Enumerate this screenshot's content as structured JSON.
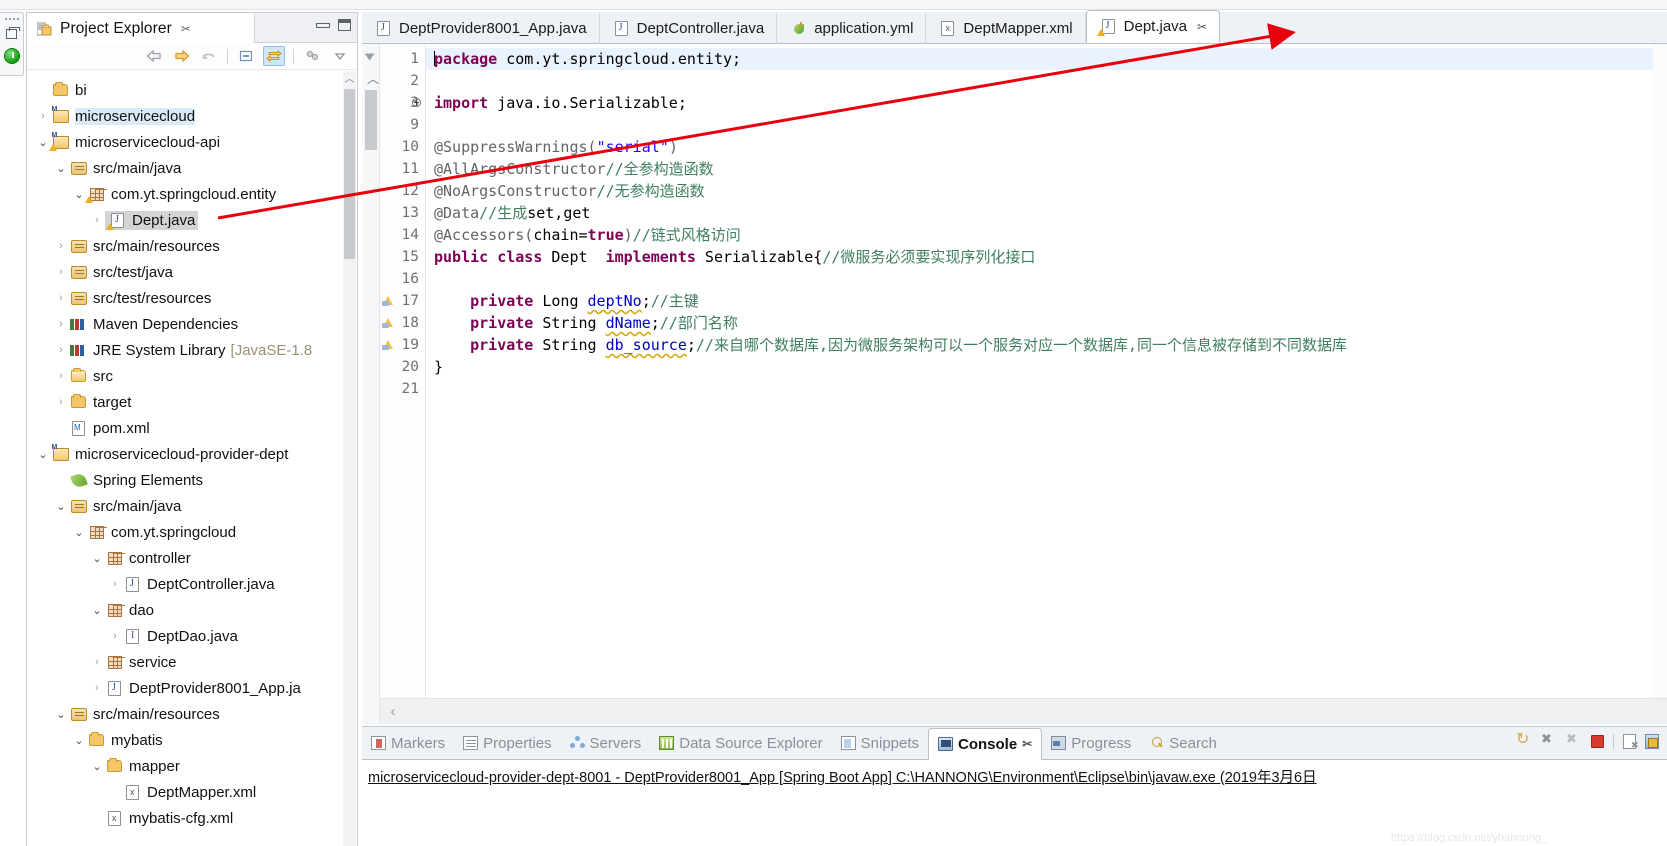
{
  "window": {
    "title": "Eclipse IDE"
  },
  "fastview": {
    "restore_tooltip": "Restore",
    "run_tooltip": "Run"
  },
  "project_explorer": {
    "title": "Project Explorer",
    "close_glyph": "✂",
    "minimize_tooltip": "Minimize",
    "maximize_tooltip": "Maximize",
    "toolbar": [
      {
        "name": "back-icon",
        "glyph": "⇦"
      },
      {
        "name": "forward-icon",
        "glyph": "⇨"
      },
      {
        "name": "up-icon",
        "glyph": "⬆"
      },
      {
        "name": "collapse-all-icon",
        "glyph": "▣"
      },
      {
        "name": "link-with-editor-icon",
        "glyph": "⇄"
      },
      {
        "name": "view-menu-icon",
        "glyph": "▽"
      }
    ],
    "tree": [
      {
        "label": "bi",
        "indent": 1,
        "arrow": "",
        "icon": "folder",
        "state": ""
      },
      {
        "label": "microservicecloud",
        "indent": 1,
        "arrow": "›",
        "icon": "proj",
        "state": "sel-blue"
      },
      {
        "label": "microservicecloud-api",
        "indent": 1,
        "arrow": "⌄",
        "icon": "proj-warn",
        "state": ""
      },
      {
        "label": "src/main/java",
        "indent": 2,
        "arrow": "⌄",
        "icon": "pkgsrc",
        "state": ""
      },
      {
        "label": "com.yt.springcloud.entity",
        "indent": 3,
        "arrow": "⌄",
        "icon": "pkg-warn",
        "state": ""
      },
      {
        "label": "Dept.java",
        "indent": 4,
        "arrow": "›",
        "icon": "java-warn",
        "state": "sel-grey"
      },
      {
        "label": "src/main/resources",
        "indent": 2,
        "arrow": "›",
        "icon": "pkgsrc",
        "state": ""
      },
      {
        "label": "src/test/java",
        "indent": 2,
        "arrow": "›",
        "icon": "pkgsrc",
        "state": ""
      },
      {
        "label": "src/test/resources",
        "indent": 2,
        "arrow": "›",
        "icon": "pkgsrc",
        "state": ""
      },
      {
        "label": "Maven Dependencies",
        "indent": 2,
        "arrow": "›",
        "icon": "lib",
        "state": ""
      },
      {
        "label": "JRE System Library ",
        "dim": "[JavaSE-1.8",
        "indent": 2,
        "arrow": "›",
        "icon": "lib",
        "state": ""
      },
      {
        "label": "src",
        "indent": 2,
        "arrow": "›",
        "icon": "folder-src",
        "state": ""
      },
      {
        "label": "target",
        "indent": 2,
        "arrow": "›",
        "icon": "folder",
        "state": ""
      },
      {
        "label": "pom.xml",
        "indent": 2,
        "arrow": "",
        "icon": "mvn",
        "state": ""
      },
      {
        "label": "microservicecloud-provider-dept",
        "indent": 1,
        "arrow": "⌄",
        "icon": "proj",
        "state": ""
      },
      {
        "label": "Spring Elements",
        "indent": 2,
        "arrow": "",
        "icon": "leaf",
        "state": ""
      },
      {
        "label": "src/main/java",
        "indent": 2,
        "arrow": "⌄",
        "icon": "pkgsrc",
        "state": ""
      },
      {
        "label": "com.yt.springcloud",
        "indent": 3,
        "arrow": "⌄",
        "icon": "pkg",
        "state": ""
      },
      {
        "label": "controller",
        "indent": 4,
        "arrow": "⌄",
        "icon": "pkg",
        "state": ""
      },
      {
        "label": "DeptController.java",
        "indent": 5,
        "arrow": "›",
        "icon": "java",
        "state": ""
      },
      {
        "label": "dao",
        "indent": 4,
        "arrow": "⌄",
        "icon": "pkg",
        "state": ""
      },
      {
        "label": "DeptDao.java",
        "indent": 5,
        "arrow": "›",
        "icon": "javai",
        "state": ""
      },
      {
        "label": "service",
        "indent": 4,
        "arrow": "›",
        "icon": "pkg",
        "state": ""
      },
      {
        "label": "DeptProvider8001_App.ja",
        "indent": 4,
        "arrow": "›",
        "icon": "java",
        "state": ""
      },
      {
        "label": "src/main/resources",
        "indent": 2,
        "arrow": "⌄",
        "icon": "pkgsrc",
        "state": ""
      },
      {
        "label": "mybatis",
        "indent": 3,
        "arrow": "⌄",
        "icon": "folder",
        "state": ""
      },
      {
        "label": "mapper",
        "indent": 4,
        "arrow": "⌄",
        "icon": "folder",
        "state": ""
      },
      {
        "label": "DeptMapper.xml",
        "indent": 5,
        "arrow": "",
        "icon": "xml",
        "state": ""
      },
      {
        "label": "mybatis-cfg.xml",
        "indent": 4,
        "arrow": "",
        "icon": "xml",
        "state": ""
      }
    ]
  },
  "editor": {
    "tabs": [
      {
        "label": "DeptProvider8001_App.java",
        "icon": "java-file-icon",
        "active": false
      },
      {
        "label": "DeptController.java",
        "icon": "java-file-icon",
        "active": false
      },
      {
        "label": "application.yml",
        "icon": "yaml-file-icon",
        "active": false
      },
      {
        "label": "DeptMapper.xml",
        "icon": "xml-file-icon",
        "active": false
      },
      {
        "label": "Dept.java",
        "icon": "java-warning-file-icon",
        "active": true
      }
    ],
    "close_glyph": "✂",
    "scroll_left_glyph": "‹",
    "lines": [
      {
        "no": "1",
        "mark": "",
        "current": true,
        "tokens": [
          {
            "c": "kw",
            "t": "package"
          },
          {
            "c": "pln",
            "t": " com.yt.springcloud.entity;"
          }
        ]
      },
      {
        "no": "2",
        "mark": "",
        "current": false,
        "tokens": []
      },
      {
        "no": "3",
        "mark": "plus",
        "current": false,
        "tokens": [
          {
            "c": "kw",
            "t": "import"
          },
          {
            "c": "pln",
            "t": " java.io.Serializable;"
          }
        ]
      },
      {
        "no": "9",
        "mark": "",
        "current": false,
        "tokens": []
      },
      {
        "no": "10",
        "mark": "",
        "current": false,
        "tokens": [
          {
            "c": "ann",
            "t": "@SuppressWarnings("
          },
          {
            "c": "str",
            "t": "\"serial\""
          },
          {
            "c": "ann",
            "t": ")"
          }
        ]
      },
      {
        "no": "11",
        "mark": "",
        "current": false,
        "tokens": [
          {
            "c": "ann",
            "t": "@AllArgsConstructor"
          },
          {
            "c": "cmt",
            "t": "//全参构造函数"
          }
        ]
      },
      {
        "no": "12",
        "mark": "",
        "current": false,
        "tokens": [
          {
            "c": "ann",
            "t": "@NoArgsConstructor"
          },
          {
            "c": "cmt",
            "t": "//无参构造函数"
          }
        ]
      },
      {
        "no": "13",
        "mark": "",
        "current": false,
        "tokens": [
          {
            "c": "ann",
            "t": "@Data"
          },
          {
            "c": "cmt",
            "t": "//生成"
          },
          {
            "c": "pln",
            "t": "set,get"
          }
        ]
      },
      {
        "no": "14",
        "mark": "",
        "current": false,
        "tokens": [
          {
            "c": "ann",
            "t": "@Accessors("
          },
          {
            "c": "pln",
            "t": "chain="
          },
          {
            "c": "kw",
            "t": "true"
          },
          {
            "c": "ann",
            "t": ")"
          },
          {
            "c": "cmt",
            "t": "//链式风格访问"
          }
        ]
      },
      {
        "no": "15",
        "mark": "",
        "current": false,
        "tokens": [
          {
            "c": "kw",
            "t": "public class"
          },
          {
            "c": "pln",
            "t": " Dept  "
          },
          {
            "c": "kw",
            "t": "implements"
          },
          {
            "c": "pln",
            "t": " Serializable{"
          },
          {
            "c": "cmt",
            "t": "//微服务必须要实现序列化接口"
          }
        ]
      },
      {
        "no": "16",
        "mark": "",
        "current": false,
        "tokens": []
      },
      {
        "no": "17",
        "mark": "warn",
        "current": false,
        "tokens": [
          {
            "c": "pln",
            "t": "    "
          },
          {
            "c": "kw",
            "t": "private"
          },
          {
            "c": "pln",
            "t": " Long "
          },
          {
            "c": "fld-u",
            "t": "deptNo"
          },
          {
            "c": "pln",
            "t": ";"
          },
          {
            "c": "cmt",
            "t": "//主键"
          }
        ]
      },
      {
        "no": "18",
        "mark": "warn",
        "current": false,
        "tokens": [
          {
            "c": "pln",
            "t": "    "
          },
          {
            "c": "kw",
            "t": "private"
          },
          {
            "c": "pln",
            "t": " String "
          },
          {
            "c": "fld-u",
            "t": "dName"
          },
          {
            "c": "pln",
            "t": ";"
          },
          {
            "c": "cmt",
            "t": "//部门名称"
          }
        ]
      },
      {
        "no": "19",
        "mark": "warn",
        "current": false,
        "tokens": [
          {
            "c": "pln",
            "t": "    "
          },
          {
            "c": "kw",
            "t": "private"
          },
          {
            "c": "pln",
            "t": " String "
          },
          {
            "c": "fld-u",
            "t": "db_source"
          },
          {
            "c": "pln",
            "t": ";"
          },
          {
            "c": "cmt",
            "t": "//来自哪个数据库,因为微服务架构可以一个服务对应一个数据库,同一个信息被存储到不同数据库"
          }
        ]
      },
      {
        "no": "20",
        "mark": "",
        "current": false,
        "tokens": [
          {
            "c": "pln",
            "t": "}"
          }
        ]
      },
      {
        "no": "21",
        "mark": "",
        "current": false,
        "tokens": []
      }
    ]
  },
  "bottom_panel": {
    "tabs": [
      {
        "label": "Markers",
        "icon": "markers-icon",
        "active": false
      },
      {
        "label": "Properties",
        "icon": "properties-icon",
        "active": false
      },
      {
        "label": "Servers",
        "icon": "servers-icon",
        "active": false
      },
      {
        "label": "Data Source Explorer",
        "icon": "data-source-explorer-icon",
        "active": false
      },
      {
        "label": "Snippets",
        "icon": "snippets-icon",
        "active": false
      },
      {
        "label": "Console",
        "icon": "console-icon",
        "active": true
      },
      {
        "label": "Progress",
        "icon": "progress-icon",
        "active": false
      },
      {
        "label": "Search",
        "icon": "search-icon",
        "active": false
      }
    ],
    "close_glyph": "✂",
    "toolbar": [
      {
        "name": "rerun-icon",
        "glyph": "↻"
      },
      {
        "name": "terminate-icon",
        "glyph": "✖"
      },
      {
        "name": "remove-all-terminated-icon",
        "glyph": "✖"
      },
      {
        "name": "stop-icon",
        "glyph": "■"
      },
      {
        "name": "clear-console-icon",
        "glyph": "▤"
      },
      {
        "name": "pin-console-icon",
        "glyph": "🔒"
      }
    ],
    "console_text": "microservicecloud-provider-dept-8001 - DeptProvider8001_App [Spring Boot App] C:\\HANNONG\\Environment\\Eclipse\\bin\\javaw.exe (2019年3月6日"
  },
  "annotation": {
    "arrow_color": "#e8000d",
    "description": "red arrow from Dept.java tree node to Dept.java editor tab"
  }
}
